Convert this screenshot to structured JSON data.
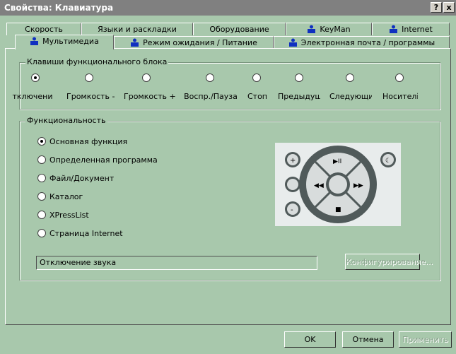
{
  "window": {
    "title": "Свойства: Клавиатура",
    "help_btn": "?",
    "close_btn": "x"
  },
  "tabs_row1": [
    "Скорость",
    "Языки и раскладки",
    "Оборудование",
    "KeyMan",
    "Internet"
  ],
  "tabs_row2": [
    "Мультимедиа",
    "Режим ожидания / Питание",
    "Электронная почта / программы"
  ],
  "keys_group": {
    "label": "Клавиши функционального блока",
    "keys": [
      "тключени",
      "Громкость -",
      "Громкость +",
      "Воспр./Пауза",
      "Стоп",
      "Предыдущи",
      "Следующи",
      "Носителі"
    ],
    "selected_index": 0
  },
  "func_group": {
    "label": "Функциональность",
    "options": [
      "Основная функция",
      "Определенная программа",
      "Файл/Документ",
      "Каталог",
      "XPressList",
      "Страница Internet"
    ],
    "selected_index": 0,
    "value_field": "Отключение звука",
    "configure_btn": "Конфигурирование..."
  },
  "footer": {
    "ok": "OK",
    "cancel": "Отмена",
    "apply": "Применить"
  },
  "colors": {
    "background": "#a8c8ac",
    "titlebar": "#808080"
  }
}
